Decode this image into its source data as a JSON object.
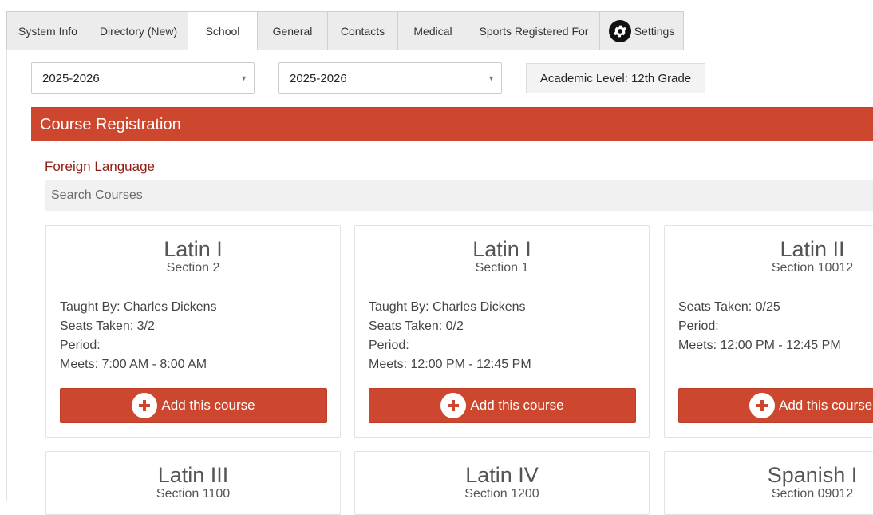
{
  "tabs": [
    {
      "label": "System Info"
    },
    {
      "label": "Directory (New)"
    },
    {
      "label": "School",
      "active": true
    },
    {
      "label": "General"
    },
    {
      "label": "Contacts"
    },
    {
      "label": "Medical"
    },
    {
      "label": "Sports Registered For"
    },
    {
      "label": "Settings",
      "icon": "gear-icon"
    }
  ],
  "filters": {
    "year_select_1": "2025-2026",
    "year_select_2": "2025-2026",
    "academic_level": "Academic Level: 12th Grade"
  },
  "registration": {
    "title": "Course Registration",
    "category": "Foreign Language",
    "search_placeholder": "Search Courses",
    "add_label": "Add this course"
  },
  "courses": [
    {
      "name": "Latin I",
      "section": "Section 2",
      "details": [
        "Taught By: Charles Dickens",
        "Seats Taken: 3/2",
        "Period:",
        "Meets: 7:00 AM - 8:00 AM"
      ]
    },
    {
      "name": "Latin I",
      "section": "Section 1",
      "details": [
        "Taught By: Charles Dickens",
        "Seats Taken: 0/2",
        "Period:",
        "Meets: 12:00 PM - 12:45 PM"
      ]
    },
    {
      "name": "Latin II",
      "section": "Section 10012",
      "details": [
        "Seats Taken: 0/25",
        "Period:",
        "Meets: 12:00 PM - 12:45 PM"
      ]
    },
    {
      "name": "Latin III",
      "section": "Section 1100"
    },
    {
      "name": "Latin IV",
      "section": "Section 1200"
    },
    {
      "name": "Spanish I",
      "section": "Section 09012"
    }
  ],
  "colors": {
    "accent": "#cd472e",
    "category_text": "#8f1d14"
  }
}
